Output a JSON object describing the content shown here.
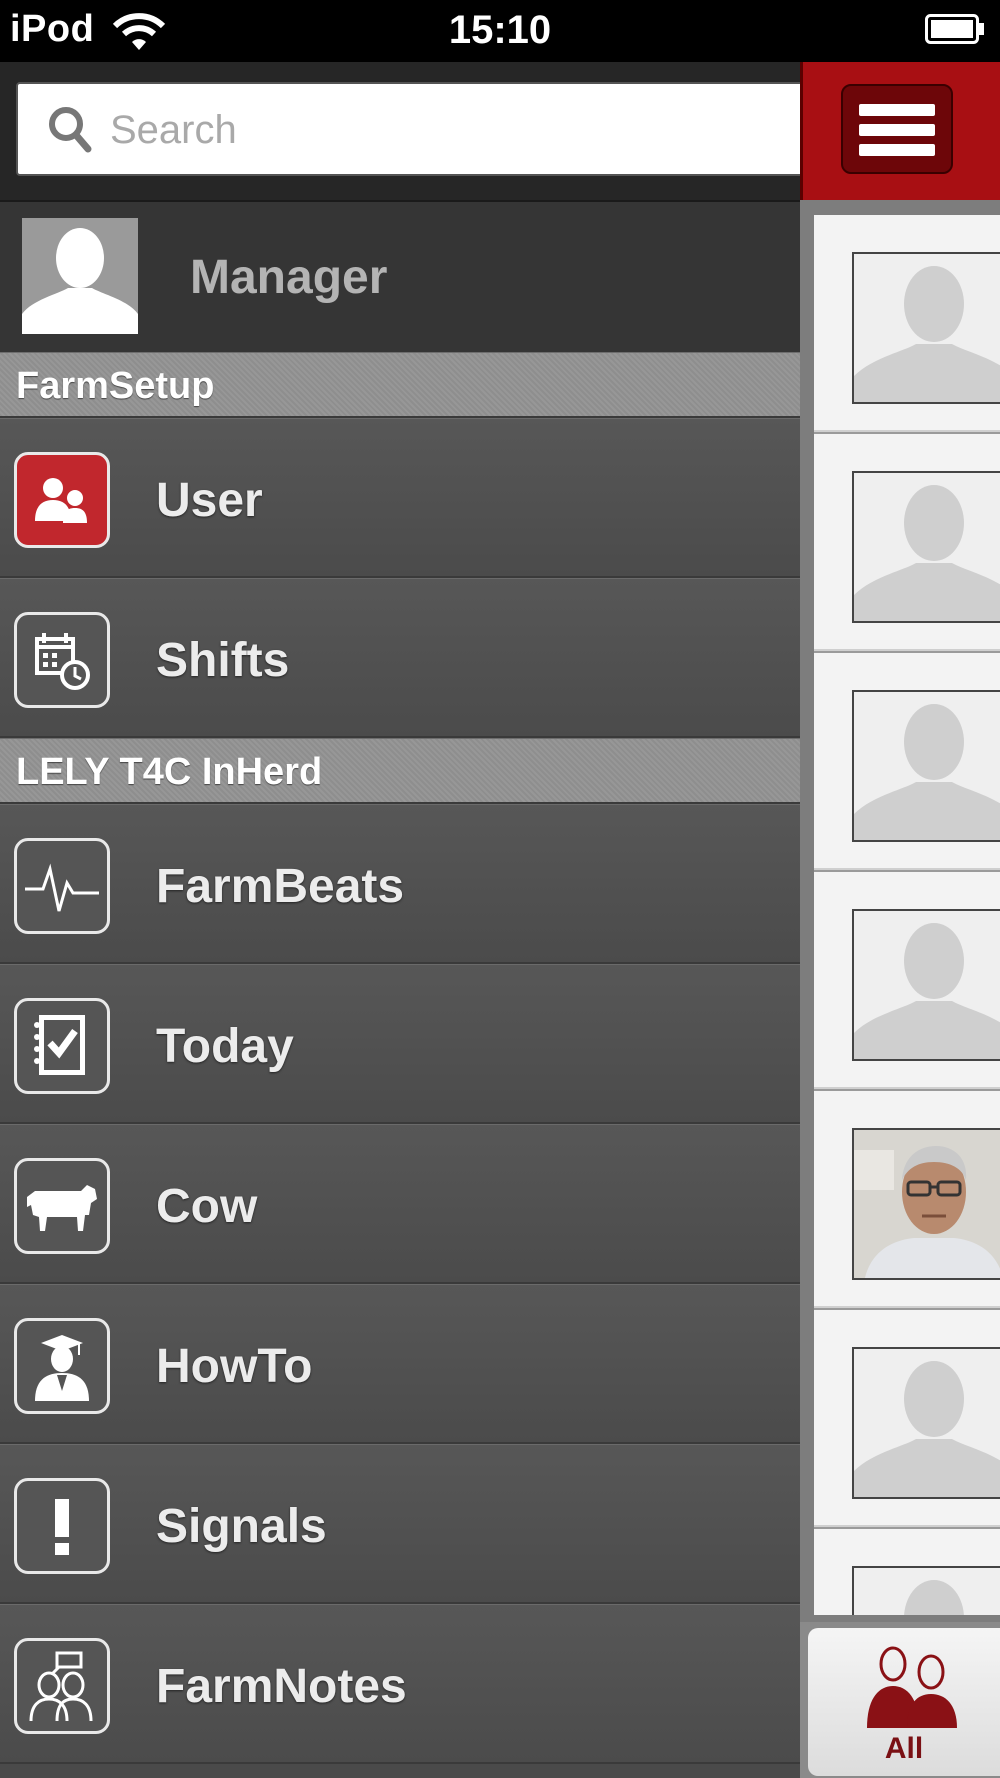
{
  "status_bar": {
    "carrier": "iPod",
    "time": "15:10"
  },
  "search": {
    "placeholder": "Search"
  },
  "profile": {
    "name": "Manager"
  },
  "sections": [
    {
      "title": "FarmSetup",
      "items": [
        {
          "label": "User",
          "icon": "user-group-icon"
        },
        {
          "label": "Shifts",
          "icon": "calendar-clock-icon"
        }
      ]
    },
    {
      "title": "LELY T4C InHerd",
      "items": [
        {
          "label": "FarmBeats",
          "icon": "heartbeat-icon"
        },
        {
          "label": "Today",
          "icon": "checklist-icon"
        },
        {
          "label": "Cow",
          "icon": "cow-icon"
        },
        {
          "label": "HowTo",
          "icon": "graduate-icon"
        },
        {
          "label": "Signals",
          "icon": "exclamation-icon"
        },
        {
          "label": "FarmNotes",
          "icon": "notes-people-icon"
        }
      ]
    }
  ],
  "tab_bar": {
    "all_label": "All"
  },
  "colors": {
    "accent_red": "#a80f13",
    "active_icon_bg": "#c1272d"
  }
}
